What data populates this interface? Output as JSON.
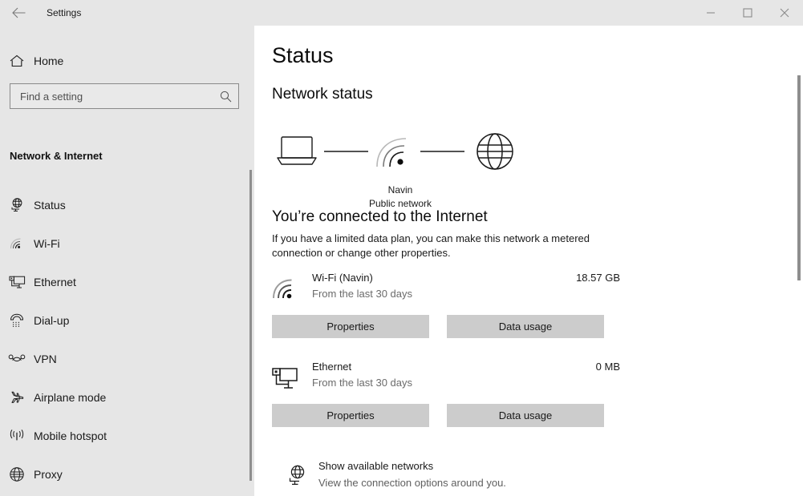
{
  "window": {
    "title": "Settings",
    "back_icon": "back-arrow-icon",
    "minimize_label": "Minimize",
    "maximize_label": "Maximize",
    "close_label": "Close"
  },
  "sidebar": {
    "home_label": "Home",
    "home_icon": "home-icon",
    "search": {
      "placeholder": "Find a setting",
      "value": "",
      "icon": "search-icon"
    },
    "section_title": "Network & Internet",
    "items": [
      {
        "label": "Status",
        "icon": "status-globe-monitor-icon",
        "selected": true
      },
      {
        "label": "Wi-Fi",
        "icon": "wifi-icon",
        "selected": false
      },
      {
        "label": "Ethernet",
        "icon": "ethernet-icon",
        "selected": false
      },
      {
        "label": "Dial-up",
        "icon": "dialup-phone-icon",
        "selected": false
      },
      {
        "label": "VPN",
        "icon": "vpn-icon",
        "selected": false
      },
      {
        "label": "Airplane mode",
        "icon": "airplane-icon",
        "selected": false
      },
      {
        "label": "Mobile hotspot",
        "icon": "hotspot-icon",
        "selected": false
      },
      {
        "label": "Proxy",
        "icon": "proxy-globe-icon",
        "selected": false
      }
    ]
  },
  "main": {
    "page_title": "Status",
    "network_status_heading": "Network status",
    "diagram": {
      "device_icon": "laptop-icon",
      "network_icon": "wifi-signal-icon",
      "internet_icon": "globe-icon",
      "network_name": "Navin",
      "network_type": "Public network"
    },
    "connected_heading": "You’re connected to the Internet",
    "connected_description": "If you have a limited data plan, you can make this network a metered connection or change other properties.",
    "adapters": [
      {
        "icon": "wifi-icon",
        "name": "Wi-Fi (Navin)",
        "subtitle": "From the last 30 days",
        "usage": "18.57 GB",
        "properties_label": "Properties",
        "data_usage_label": "Data usage"
      },
      {
        "icon": "ethernet-icon",
        "name": "Ethernet",
        "subtitle": "From the last 30 days",
        "usage": "0 MB",
        "properties_label": "Properties",
        "data_usage_label": "Data usage"
      }
    ],
    "show_available_networks": {
      "icon": "globe-monitor-icon",
      "title": "Show available networks",
      "subtitle": "View the connection options around you."
    }
  },
  "colors": {
    "chrome": "#e6e6e6",
    "content": "#ffffff",
    "button": "#cccccc",
    "text": "#1a1a1a",
    "muted_text": "#6b6b6b",
    "scrollbar_thumb": "#8e8e8e"
  }
}
